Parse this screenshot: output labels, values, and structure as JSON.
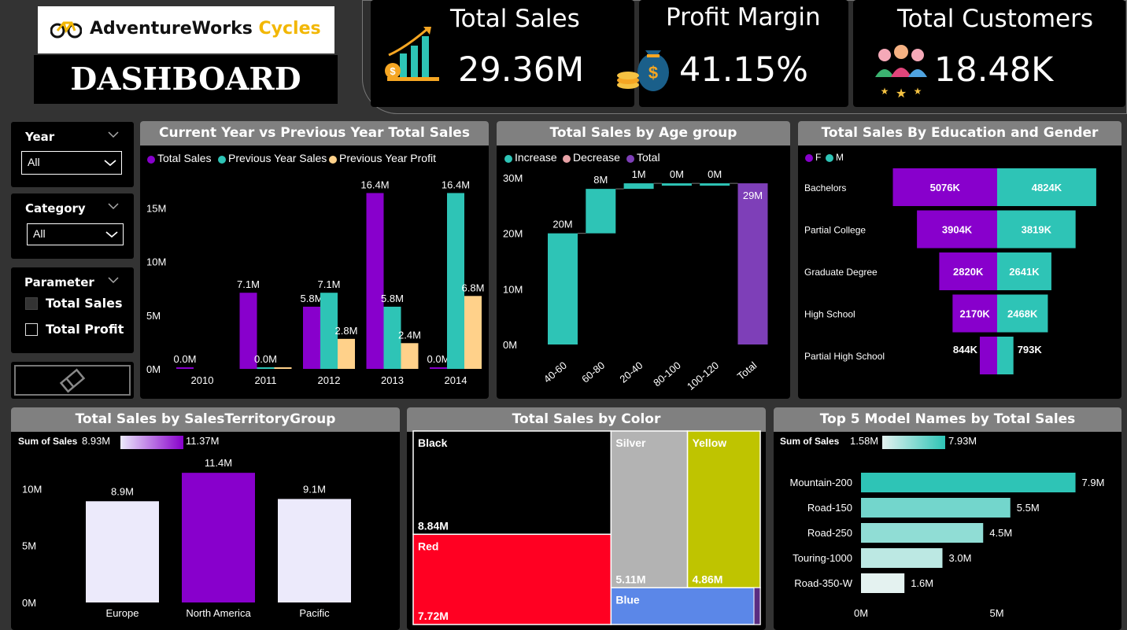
{
  "logo": {
    "brand_dark": "AdventureWorks",
    "brand_accent": "Cycles"
  },
  "dashboard_title": "DASHBOARD",
  "kpis": {
    "total_sales": {
      "title": "Total Sales",
      "value": "29.36M"
    },
    "profit_margin": {
      "title": "Profit Margin",
      "value": "41.15%"
    },
    "total_customers": {
      "title": "Total Customers",
      "value": "18.48K"
    }
  },
  "slicers": {
    "year": {
      "title": "Year",
      "value": "All"
    },
    "category": {
      "title": "Category",
      "value": "All"
    },
    "parameter": {
      "title": "Parameter",
      "options": [
        "Total Sales",
        "Total Profit"
      ],
      "selected": "Total Sales"
    }
  },
  "colors": {
    "purple": "#8800CC",
    "teal": "#2EC4B6",
    "peach": "#FFD18A",
    "total_purple": "#7E3FB8",
    "decrease_pink": "#E8A2A6",
    "panel_header": "#808080",
    "background": "#333333"
  },
  "charts": {
    "cy_vs_py": {
      "title": "Current Year vs Previous Year Total Sales",
      "legend": [
        "Total Sales",
        "Previous Year Sales",
        "Previous Year Profit"
      ],
      "yticks": [
        "0M",
        "5M",
        "10M",
        "15M"
      ]
    },
    "age_group": {
      "title": "Total Sales by Age group",
      "legend": [
        "Increase",
        "Decrease",
        "Total"
      ],
      "yticks": [
        "0M",
        "10M",
        "20M",
        "30M"
      ]
    },
    "education_gender": {
      "title": "Total Sales By Education and Gender",
      "legend": [
        "F",
        "M"
      ]
    },
    "territory": {
      "title": "Total Sales by SalesTerritoryGroup",
      "scale_label": "Sum of Sales",
      "scale_min": "8.93M",
      "scale_max": "11.37M",
      "yticks": [
        "0M",
        "5M",
        "10M"
      ]
    },
    "color": {
      "title": "Total Sales by Color"
    },
    "top_models": {
      "title": "Top 5 Model Names by Total Sales",
      "scale_label": "Sum of Sales",
      "scale_min": "1.58M",
      "scale_max": "7.93M",
      "xticks": [
        "0M",
        "5M"
      ]
    }
  },
  "chart_data": [
    {
      "type": "bar",
      "title": "Current Year vs Previous Year Total Sales",
      "categories": [
        "2010",
        "2011",
        "2012",
        "2013",
        "2014"
      ],
      "series": [
        {
          "name": "Total Sales",
          "values": [
            0.0,
            7.1,
            5.8,
            16.4,
            0.0
          ],
          "labels": [
            "0.0M",
            "7.1M",
            "5.8M",
            "16.4M",
            "0.0M"
          ]
        },
        {
          "name": "Previous Year Sales",
          "values": [
            null,
            0.0,
            7.1,
            5.8,
            16.4
          ],
          "labels": [
            "",
            "0.0M",
            "7.1M",
            "5.8M",
            "16.4M"
          ]
        },
        {
          "name": "Previous Year Profit",
          "values": [
            null,
            0.0,
            2.8,
            2.4,
            6.8
          ],
          "labels": [
            "",
            "",
            "2.8M",
            "2.4M",
            "6.8M"
          ]
        }
      ],
      "ylim": [
        0,
        19
      ]
    },
    {
      "type": "bar",
      "title": "Total Sales by Age group",
      "categories": [
        "40-60",
        "60-80",
        "20-40",
        "80-100",
        "100-120",
        "Total"
      ],
      "values": [
        20,
        8,
        1,
        0,
        0,
        29
      ],
      "labels": [
        "20M",
        "8M",
        "1M",
        "0M",
        "0M",
        "29M"
      ],
      "kind": [
        "increase",
        "increase",
        "increase",
        "increase",
        "increase",
        "total"
      ],
      "ylim": [
        0,
        30
      ]
    },
    {
      "type": "bar",
      "title": "Total Sales By Education and Gender",
      "categories": [
        "Bachelors",
        "Partial College",
        "Graduate Degree",
        "High School",
        "Partial High School"
      ],
      "series": [
        {
          "name": "F",
          "values": [
            5076,
            3904,
            2820,
            2170,
            844
          ],
          "labels": [
            "5076K",
            "3904K",
            "2820K",
            "2170K",
            "844K"
          ]
        },
        {
          "name": "M",
          "values": [
            4824,
            3819,
            2641,
            2468,
            793
          ],
          "labels": [
            "4824K",
            "3819K",
            "2641K",
            "2468K",
            "793K"
          ]
        }
      ]
    },
    {
      "type": "bar",
      "title": "Total Sales by SalesTerritoryGroup",
      "categories": [
        "Europe",
        "North America",
        "Pacific"
      ],
      "values": [
        8.9,
        11.4,
        9.1
      ],
      "labels": [
        "8.9M",
        "11.4M",
        "9.1M"
      ],
      "ylim": [
        0,
        13
      ]
    },
    {
      "type": "treemap",
      "title": "Total Sales by Color",
      "categories": [
        "Black",
        "Red",
        "Silver",
        "Yellow",
        "Blue"
      ],
      "values": [
        8.84,
        7.72,
        5.11,
        4.86,
        null
      ],
      "labels": [
        "8.84M",
        "7.72M",
        "5.11M",
        "4.86M",
        ""
      ],
      "colors": [
        "#000000",
        "#FF0022",
        "#B3B3B3",
        "#BFC400",
        "#5B87E8"
      ]
    },
    {
      "type": "bar",
      "title": "Top 5 Model Names by Total Sales",
      "categories": [
        "Mountain-200",
        "Road-150",
        "Road-250",
        "Touring-1000",
        "Road-350-W"
      ],
      "values": [
        7.9,
        5.5,
        4.5,
        3.0,
        1.6
      ],
      "labels": [
        "7.9M",
        "5.5M",
        "4.5M",
        "3.0M",
        "1.6M"
      ],
      "xlim": [
        0,
        8
      ]
    }
  ]
}
